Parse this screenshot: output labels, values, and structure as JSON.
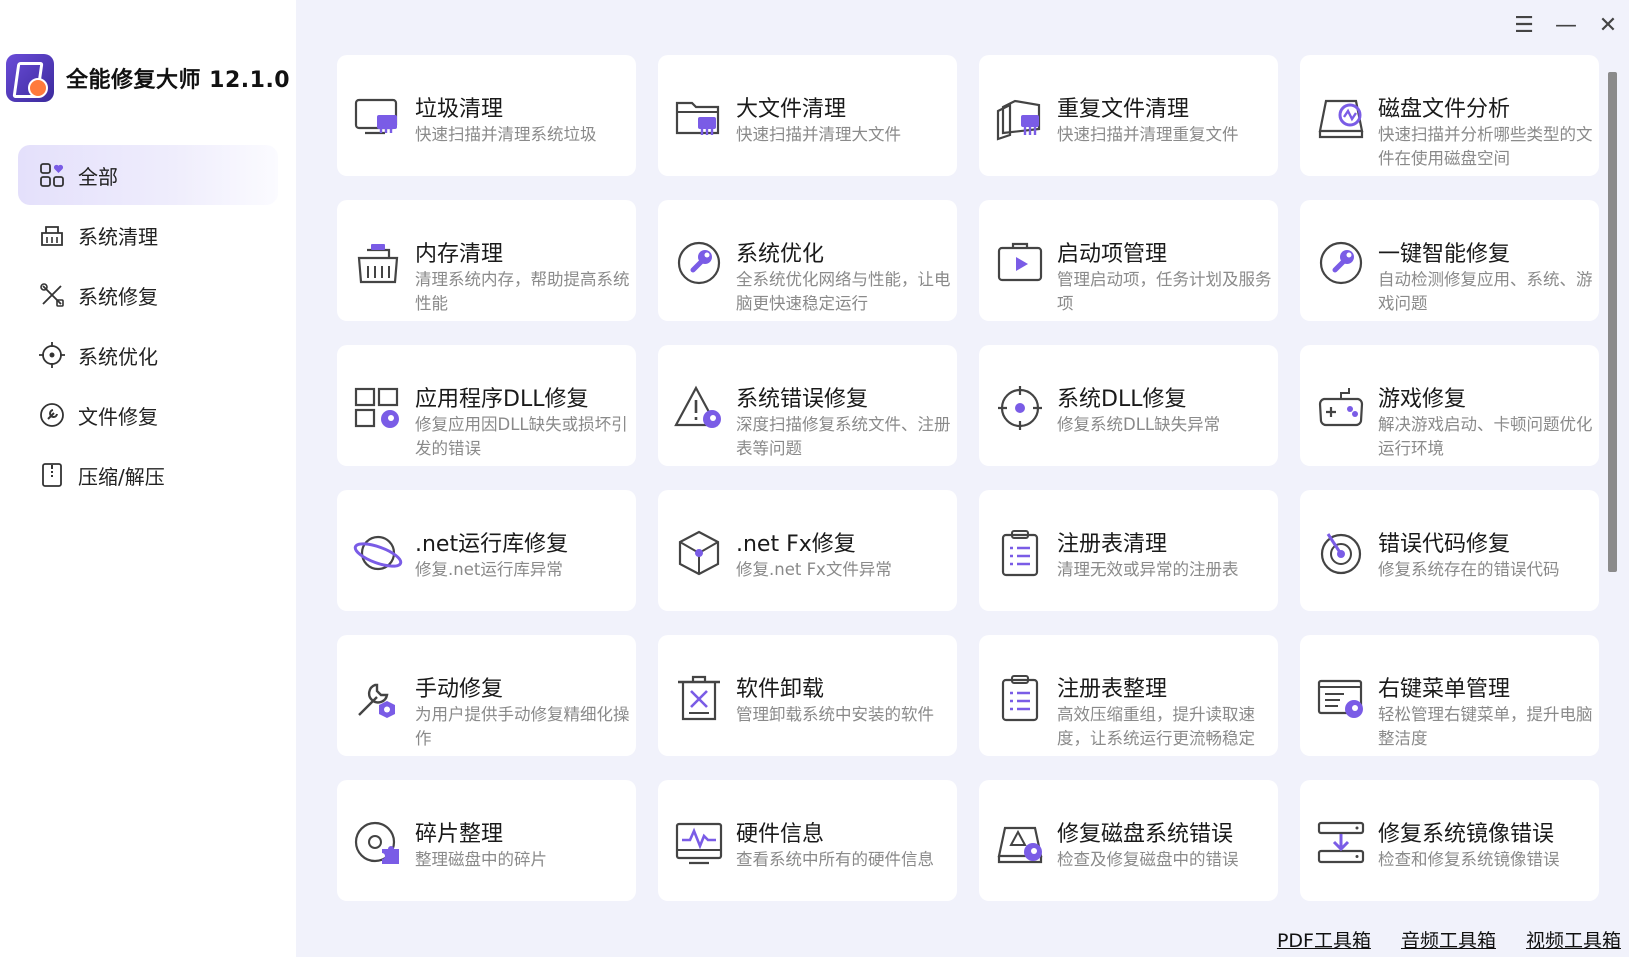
{
  "app": {
    "title": "全能修复大师 12.1.0"
  },
  "window_controls": {
    "menu": "☰",
    "minimize": "—",
    "close": "✕"
  },
  "sidebar": {
    "items": [
      {
        "label": "全部",
        "icon": "grid-heart-icon",
        "active": true
      },
      {
        "label": "系统清理",
        "icon": "broom-basket-icon",
        "active": false
      },
      {
        "label": "系统修复",
        "icon": "tools-icon",
        "active": false
      },
      {
        "label": "系统优化",
        "icon": "target-icon",
        "active": false
      },
      {
        "label": "文件修复",
        "icon": "wrench-circle-icon",
        "active": false
      },
      {
        "label": "压缩/解压",
        "icon": "zip-file-icon",
        "active": false
      }
    ]
  },
  "cards": [
    {
      "title": "垃圾清理",
      "desc": "快速扫描并清理系统垃圾",
      "icon": "monitor-broom-icon"
    },
    {
      "title": "大文件清理",
      "desc": "快速扫描并清理大文件",
      "icon": "folder-broom-icon"
    },
    {
      "title": "重复文件清理",
      "desc": "快速扫描并清理重复文件",
      "icon": "files-broom-icon"
    },
    {
      "title": "磁盘文件分析",
      "desc": "快速扫描并分析哪些类型的文件在使用磁盘空间",
      "icon": "disk-chart-icon"
    },
    {
      "title": "内存清理",
      "desc": "清理系统内存，帮助提高系统性能",
      "icon": "memory-broom-icon"
    },
    {
      "title": "系统优化",
      "desc": "全系统优化网络与性能，让电脑更快速稳定运行",
      "icon": "wrench-circle-icon"
    },
    {
      "title": "启动项管理",
      "desc": "管理启动项，任务计划及服务项",
      "icon": "startup-play-icon"
    },
    {
      "title": "一键智能修复",
      "desc": "自动检测修复应用、系统、游戏问题",
      "icon": "wrench-circle-icon"
    },
    {
      "title": "应用程序DLL修复",
      "desc": "修复应用因DLL缺失或损坏引发的错误",
      "icon": "app-grid-repair-icon"
    },
    {
      "title": "系统错误修复",
      "desc": "深度扫描修复系统文件、注册表等问题",
      "icon": "warning-repair-icon"
    },
    {
      "title": "系统DLL修复",
      "desc": "修复系统DLL缺失异常",
      "icon": "crosshair-icon"
    },
    {
      "title": "游戏修复",
      "desc": "解决游戏启动、卡顿问题优化运行环境",
      "icon": "gamepad-icon"
    },
    {
      "title": ".net运行库修复",
      "desc": "修复.net运行库异常",
      "icon": "planet-icon"
    },
    {
      "title": ".net Fx修复",
      "desc": "修复.net Fx文件异常",
      "icon": "cube-icon"
    },
    {
      "title": "注册表清理",
      "desc": "清理无效或异常的注册表",
      "icon": "clipboard-list-icon"
    },
    {
      "title": "错误代码修复",
      "desc": "修复系统存在的错误代码",
      "icon": "radar-icon"
    },
    {
      "title": "手动修复",
      "desc": "为用户提供手动修复精细化操作",
      "icon": "wrench-gear-icon"
    },
    {
      "title": "软件卸载",
      "desc": "管理卸载系统中安装的软件",
      "icon": "trash-icon"
    },
    {
      "title": "注册表整理",
      "desc": "高效压缩重组，提升读取速度，让系统运行更流畅稳定",
      "icon": "clipboard-list-icon"
    },
    {
      "title": "右键菜单管理",
      "desc": "轻松管理右键菜单，提升电脑整洁度",
      "icon": "menu-window-icon"
    },
    {
      "title": "碎片整理",
      "desc": "整理磁盘中的碎片",
      "icon": "disc-puzzle-icon"
    },
    {
      "title": "硬件信息",
      "desc": "查看系统中所有的硬件信息",
      "icon": "monitor-pulse-icon"
    },
    {
      "title": "修复磁盘系统错误",
      "desc": "检查及修复磁盘中的错误",
      "icon": "disk-warning-icon"
    },
    {
      "title": "修复系统镜像错误",
      "desc": "检查和修复系统镜像错误",
      "icon": "drive-download-icon"
    }
  ],
  "bottom_links": [
    "PDF工具箱",
    "音频工具箱",
    "视频工具箱"
  ],
  "colors": {
    "accent": "#7a5ce6",
    "background": "#f1f2fb",
    "card": "#ffffff"
  }
}
